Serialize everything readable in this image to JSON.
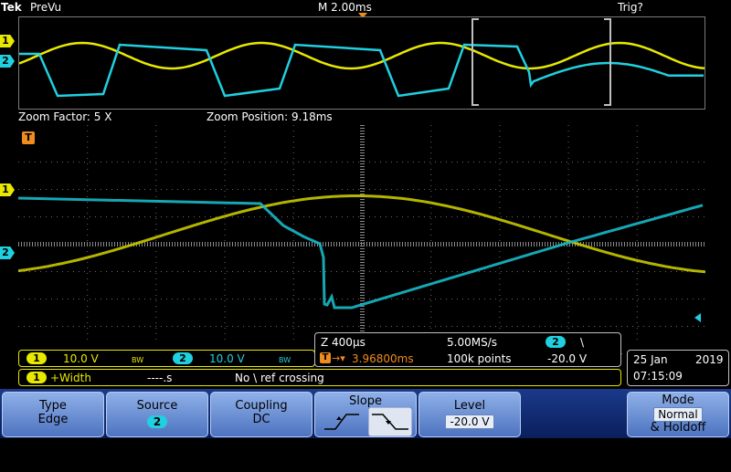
{
  "top_bar": {
    "brand": "Tek",
    "mode": "PreVu",
    "timebase": "M 2.00ms",
    "trigger_status": "Trig?"
  },
  "overview": {
    "ch1_marker": "1",
    "ch2_marker": "2",
    "trigger_marker": "T"
  },
  "zoom": {
    "factor": "Zoom Factor: 5 X",
    "position": "Zoom Position: 9.18ms"
  },
  "main": {
    "trigger_marker": "T",
    "ch1_marker": "1",
    "ch2_marker": "2"
  },
  "channels": {
    "ch1_num": "1",
    "ch1_scale": "10.0 V",
    "ch1_bw": "BW",
    "ch2_num": "2",
    "ch2_scale": "10.0 V",
    "ch2_bw": "BW"
  },
  "measurement": {
    "num": "1",
    "name": "+Width",
    "value": "----.s",
    "note": "No \\ ref crossing"
  },
  "acquisition": {
    "zoom_scale": "Z 400µs",
    "sample_rate": "5.00MS/s",
    "trig_source": "2",
    "trig_slope_glyph": "\\",
    "trig_pos": "3.96800ms",
    "points": "100k points",
    "trig_level": "-20.0 V"
  },
  "datetime": {
    "date": "25 Jan",
    "year": "2019",
    "time": "07:15:09"
  },
  "menu": {
    "type_label": "Type",
    "type_value": "Edge",
    "source_label": "Source",
    "source_value": "2",
    "coupling_label": "Coupling",
    "coupling_value": "DC",
    "slope_label": "Slope",
    "level_label": "Level",
    "level_value": "-20.0 V",
    "mode_label": "Mode",
    "mode_value": "Normal",
    "mode_sub": "& Holdoff"
  },
  "colors": {
    "ch1": "#e8e800",
    "ch2": "#20d0e0",
    "trigger": "#f08c1e",
    "grid": "#5a5a5a"
  }
}
